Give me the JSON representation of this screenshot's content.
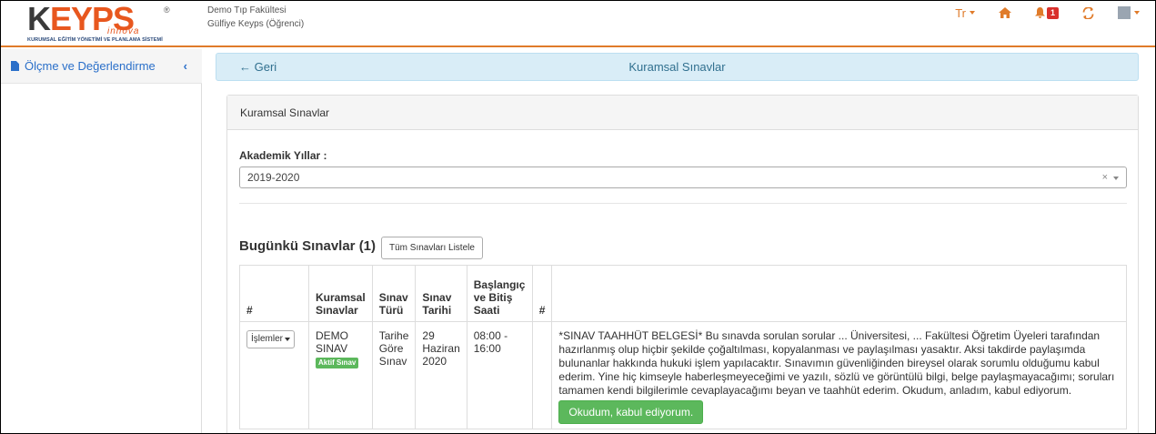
{
  "logo": {
    "wordmark_k": "K",
    "wordmark_rest": "EYPS",
    "registered": "®",
    "sub": "innova",
    "tagline": "KURUMSAL EĞİTİM YÖNETİMİ VE PLANLAMA SİSTEMİ"
  },
  "topbar": {
    "faculty": "Demo Tıp Fakültesi",
    "user": "Gülfiye Keyps (Öğrenci)",
    "language": "Tr",
    "notification_count": "1",
    "accent_color": "#e07b2a",
    "icons": [
      "home-icon",
      "bell-icon",
      "refresh-icon",
      "avatar-icon"
    ]
  },
  "sidebar": {
    "items": [
      {
        "label": "Ölçme ve Değerlendirme",
        "icon": "file-icon"
      }
    ]
  },
  "pagebar": {
    "back_label": "← Geri",
    "title": "Kuramsal Sınavlar"
  },
  "panel": {
    "heading": "Kuramsal Sınavlar",
    "years_label": "Akademik Yıllar :",
    "years_value": "2019-2020",
    "clear_glyph": "×",
    "today_title": "Bugünkü Sınavlar (1)",
    "list_all_label": "Tüm Sınavları Listele"
  },
  "table": {
    "headers": [
      "#",
      "Kuramsal Sınavlar",
      "Sınav Türü",
      "Sınav Tarihi",
      "Başlangıç ve Bitiş Saati",
      "#",
      ""
    ],
    "rows": [
      {
        "ops_label": "İşlemler",
        "exam_name": "DEMO SINAV",
        "status_badge": "Aktif Sınav",
        "exam_type": "Tarihe Göre Sınav",
        "exam_date": "29 Haziran 2020",
        "time_range": "08:00 - 16:00",
        "hash": "",
        "commitment": "*SINAV TAAHHÜT BELGESİ* Bu sınavda sorulan sorular ... Üniversitesi, ... Fakültesi Öğretim Üyeleri tarafından hazırlanmış olup hiçbir şekilde çoğaltılması, kopyalanması ve paylaşılması yasaktır. Aksi takdirde paylaşımda bulunanlar hakkında hukuki işlem yapılacaktır. Sınavımın güvenliğinden bireysel olarak sorumlu olduğumu kabul ederim. Yine hiç kimseyle haberleşmeyeceğimi ve yazılı, sözlü ve görüntülü bilgi, belge paylaşmayacağımı; soruları tamamen kendi bilgilerimle cevaplayacağımı beyan ve taahhüt ederim. Okudum, anladım, kabul ediyorum.",
        "accept_label": "Okudum, kabul ediyorum."
      }
    ]
  }
}
